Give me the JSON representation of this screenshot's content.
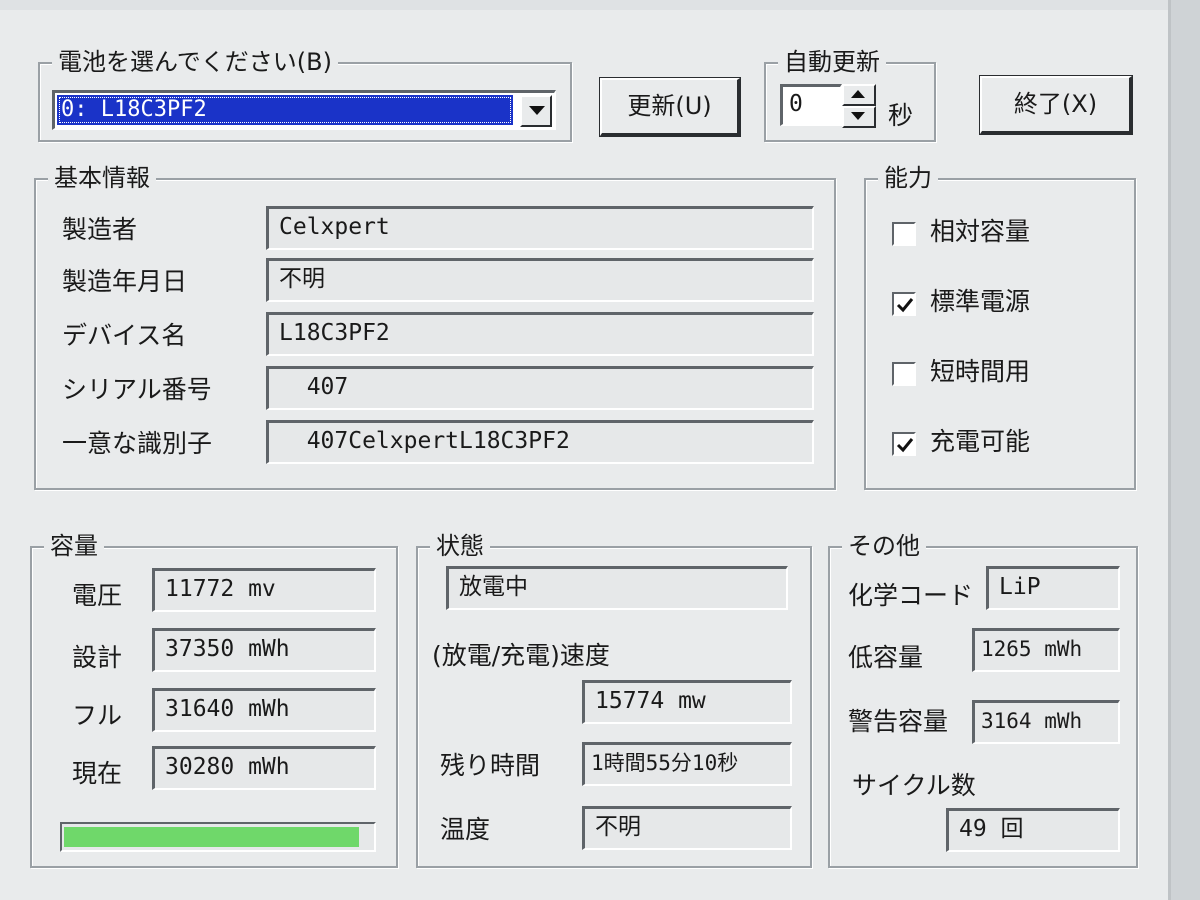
{
  "window": {
    "battery_select_label": "電池を選んでください(B)",
    "battery_selected": "0: L18C3PF2",
    "refresh_button": "更新(U)",
    "auto_update_label": "自動更新",
    "auto_update_value": "0",
    "auto_update_unit": "秒",
    "exit_button": "終了(X)"
  },
  "basic_info": {
    "title": "基本情報",
    "rows": [
      {
        "label": "製造者",
        "value": "Celxpert"
      },
      {
        "label": "製造年月日",
        "value": "不明"
      },
      {
        "label": "デバイス名",
        "value": "L18C3PF2"
      },
      {
        "label": "シリアル番号",
        "value": "  407"
      },
      {
        "label": "一意な識別子",
        "value": "  407CelxpertL18C3PF2"
      }
    ]
  },
  "capability": {
    "title": "能力",
    "items": [
      {
        "label": "相対容量",
        "checked": false
      },
      {
        "label": "標準電源",
        "checked": true
      },
      {
        "label": "短時間用",
        "checked": false
      },
      {
        "label": "充電可能",
        "checked": true
      }
    ]
  },
  "capacity": {
    "title": "容量",
    "rows": [
      {
        "label": "電圧",
        "value": "11772 mv"
      },
      {
        "label": "設計",
        "value": "37350 mWh"
      },
      {
        "label": "フル",
        "value": "31640 mWh"
      },
      {
        "label": "現在",
        "value": "30280 mWh"
      }
    ],
    "charge_fraction": 0.957,
    "bar_color": "#6fd86a"
  },
  "status": {
    "title": "状態",
    "state": "放電中",
    "rate_label": "(放電/充電)速度",
    "rate_value": "15774 mw",
    "remaining_label": "残り時間",
    "remaining_value": "1時間55分10秒",
    "temp_label": "温度",
    "temp_value": "不明"
  },
  "other": {
    "title": "その他",
    "chem_label": "化学コード",
    "chem_value": "LiP",
    "low_label": "低容量",
    "low_value": "1265 mWh",
    "warn_label": "警告容量",
    "warn_value": "3164 mWh",
    "cycle_label": "サイクル数",
    "cycle_value": "49 回"
  },
  "colors": {
    "selection": "#1a33c8",
    "dialog_face": "#e9ebec"
  }
}
